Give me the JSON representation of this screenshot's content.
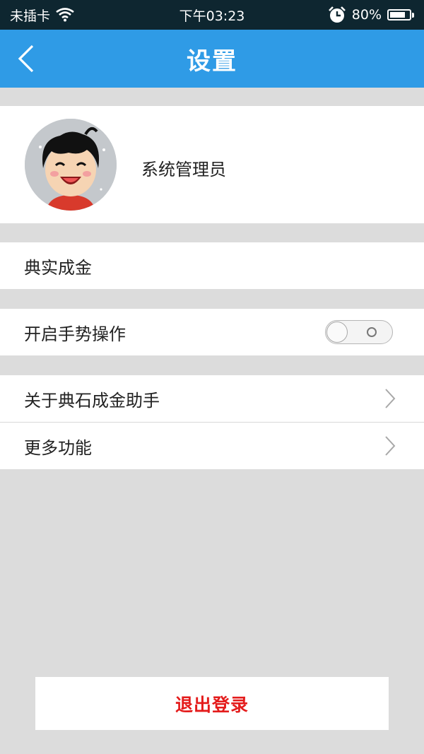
{
  "status": {
    "carrier": "未插卡",
    "time": "下午03:23",
    "battery_text": "80%",
    "battery_level": 0.8
  },
  "nav": {
    "title": "设置"
  },
  "profile": {
    "name": "系统管理员"
  },
  "rows": {
    "pawn": "典实成金",
    "gesture": "开启手势操作",
    "gesture_enabled": false,
    "about": "关于典石成金助手",
    "more": "更多功能"
  },
  "logout_label": "退出登录",
  "colors": {
    "nav_bg": "#2f9be6",
    "status_bg": "#0e2630",
    "page_bg": "#dcdcdc",
    "logout_text": "#e41b1b"
  }
}
